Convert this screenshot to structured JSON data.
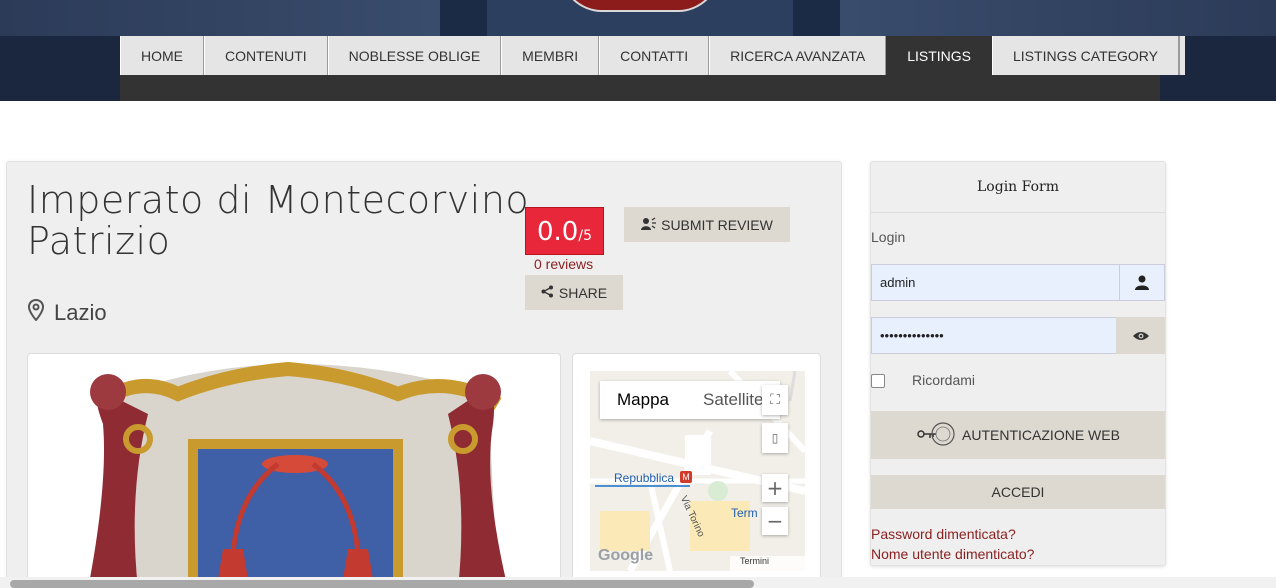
{
  "nav": {
    "items": [
      {
        "label": "HOME"
      },
      {
        "label": "CONTENUTI"
      },
      {
        "label": "NOBLESSE OBLIGE"
      },
      {
        "label": "MEMBRI"
      },
      {
        "label": "CONTATTI"
      },
      {
        "label": "RICERCA AVANZATA"
      },
      {
        "label": "LISTINGS"
      },
      {
        "label": "LISTINGS CATEGORY"
      }
    ],
    "active": "LISTINGS"
  },
  "listing": {
    "title": "Imperato di Montecorvino Patrizio",
    "rating_value": "0.0",
    "rating_max": "/5",
    "reviews": "0 reviews",
    "submit_review": "SUBMIT REVIEW",
    "share": "SHARE",
    "location": "Lazio"
  },
  "map": {
    "tab_map": "Mappa",
    "tab_satellite": "Satellite",
    "station_label": "Repubblica",
    "street_label": "Via Torino",
    "term_label": "Term",
    "terms": "Termini",
    "zoom_in": "+",
    "zoom_out": "−",
    "google": "Google"
  },
  "login": {
    "title": "Login Form",
    "login_label": "Login",
    "username_value": "admin",
    "password_value": "••••••••••••••",
    "remember": "Ricordami",
    "auth_web": "AUTENTICAZIONE WEB",
    "submit": "ACCEDI",
    "forgot_password": "Password dimenticata?",
    "forgot_username": "Nome utente dimenticato?"
  },
  "colors": {
    "accent_red": "#e8273a",
    "nav_active": "#333333",
    "link": "#8a1f1f"
  }
}
